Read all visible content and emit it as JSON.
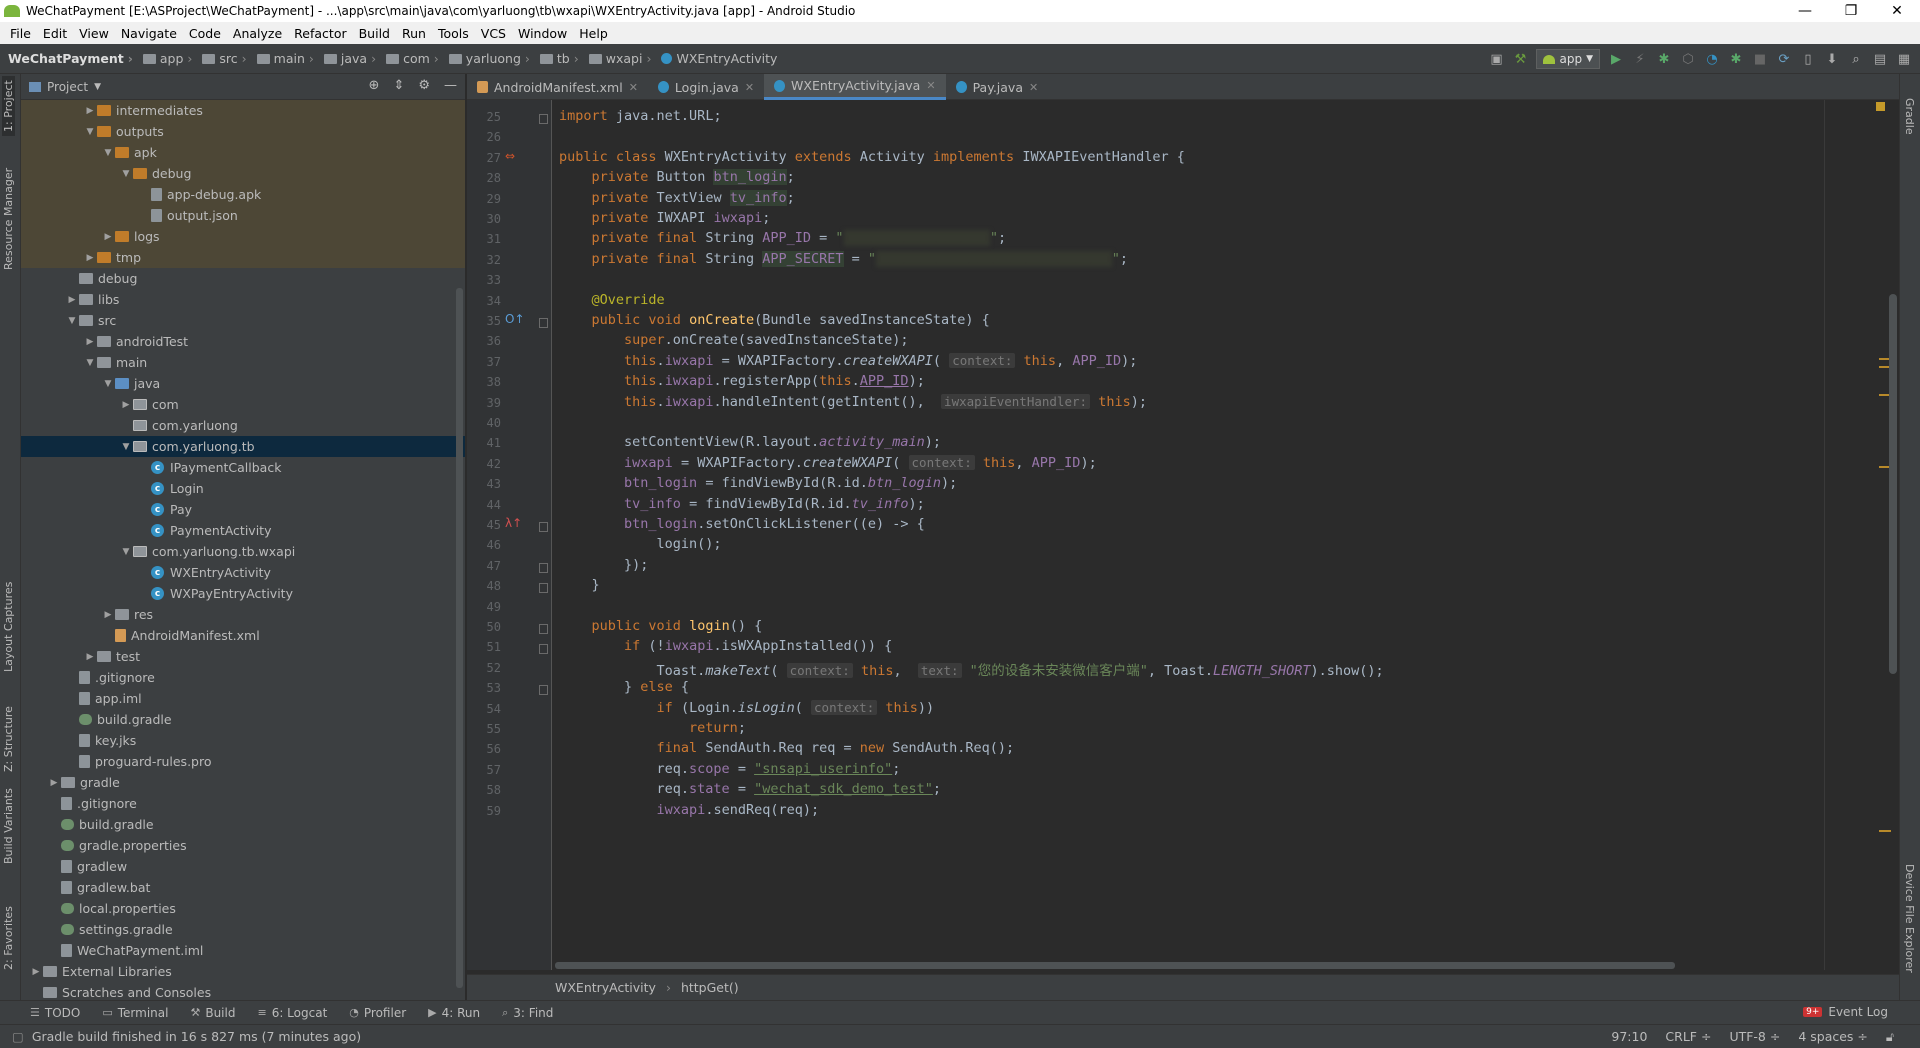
{
  "window": {
    "title": "WeChatPayment [E:\\ASProject\\WeChatPayment] - ...\\app\\src\\main\\java\\com\\yarluong\\tb\\wxapi\\WXEntryActivity.java [app] - Android Studio",
    "minimize": "—",
    "maximize": "❐",
    "close": "✕"
  },
  "menu": [
    "File",
    "Edit",
    "View",
    "Navigate",
    "Code",
    "Analyze",
    "Refactor",
    "Build",
    "Run",
    "Tools",
    "VCS",
    "Window",
    "Help"
  ],
  "breadcrumbs": [
    "WeChatPayment",
    "app",
    "src",
    "main",
    "java",
    "com",
    "yarluong",
    "tb",
    "wxapi",
    "WXEntryActivity"
  ],
  "run_config": "app",
  "left_strip": [
    "1: Project",
    "Resource Manager",
    "Layout Captures",
    "Z: Structure",
    "Build Variants",
    "2: Favorites"
  ],
  "right_strip": [
    "Gradle",
    "Device File Explorer"
  ],
  "project_panel": {
    "title": "Project",
    "tree": [
      {
        "label": "intermediates",
        "depth": 3,
        "arrow": "▶",
        "icon": "orange",
        "state": "excluded"
      },
      {
        "label": "outputs",
        "depth": 3,
        "arrow": "▼",
        "icon": "orange",
        "state": "excluded"
      },
      {
        "label": "apk",
        "depth": 4,
        "arrow": "▼",
        "icon": "orange",
        "state": "excluded"
      },
      {
        "label": "debug",
        "depth": 5,
        "arrow": "▼",
        "icon": "orange",
        "state": "excluded"
      },
      {
        "label": "app-debug.apk",
        "depth": 6,
        "arrow": "",
        "icon": "file",
        "state": "excluded"
      },
      {
        "label": "output.json",
        "depth": 6,
        "arrow": "",
        "icon": "file",
        "state": "excluded"
      },
      {
        "label": "logs",
        "depth": 4,
        "arrow": "▶",
        "icon": "orange",
        "state": "excluded"
      },
      {
        "label": "tmp",
        "depth": 3,
        "arrow": "▶",
        "icon": "orange",
        "state": "excluded"
      },
      {
        "label": "debug",
        "depth": 2,
        "arrow": "",
        "icon": "folder",
        "state": ""
      },
      {
        "label": "libs",
        "depth": 2,
        "arrow": "▶",
        "icon": "folder",
        "state": ""
      },
      {
        "label": "src",
        "depth": 2,
        "arrow": "▼",
        "icon": "folder",
        "state": ""
      },
      {
        "label": "androidTest",
        "depth": 3,
        "arrow": "▶",
        "icon": "folder",
        "state": ""
      },
      {
        "label": "main",
        "depth": 3,
        "arrow": "▼",
        "icon": "folder",
        "state": ""
      },
      {
        "label": "java",
        "depth": 4,
        "arrow": "▼",
        "icon": "blue",
        "state": ""
      },
      {
        "label": "com",
        "depth": 5,
        "arrow": "▶",
        "icon": "pkg",
        "state": ""
      },
      {
        "label": "com.yarluong",
        "depth": 5,
        "arrow": "",
        "icon": "pkg",
        "state": ""
      },
      {
        "label": "com.yarluong.tb",
        "depth": 5,
        "arrow": "▼",
        "icon": "pkg",
        "state": "selected"
      },
      {
        "label": "IPaymentCallback",
        "depth": 6,
        "arrow": "",
        "icon": "class",
        "state": ""
      },
      {
        "label": "Login",
        "depth": 6,
        "arrow": "",
        "icon": "class",
        "state": ""
      },
      {
        "label": "Pay",
        "depth": 6,
        "arrow": "",
        "icon": "class",
        "state": ""
      },
      {
        "label": "PaymentActivity",
        "depth": 6,
        "arrow": "",
        "icon": "class",
        "state": ""
      },
      {
        "label": "com.yarluong.tb.wxapi",
        "depth": 5,
        "arrow": "▼",
        "icon": "pkg",
        "state": ""
      },
      {
        "label": "WXEntryActivity",
        "depth": 6,
        "arrow": "",
        "icon": "class",
        "state": ""
      },
      {
        "label": "WXPayEntryActivity",
        "depth": 6,
        "arrow": "",
        "icon": "class",
        "state": ""
      },
      {
        "label": "res",
        "depth": 4,
        "arrow": "▶",
        "icon": "folder",
        "state": ""
      },
      {
        "label": "AndroidManifest.xml",
        "depth": 4,
        "arrow": "",
        "icon": "xml",
        "state": ""
      },
      {
        "label": "test",
        "depth": 3,
        "arrow": "▶",
        "icon": "folder",
        "state": ""
      },
      {
        "label": ".gitignore",
        "depth": 2,
        "arrow": "",
        "icon": "file",
        "state": ""
      },
      {
        "label": "app.iml",
        "depth": 2,
        "arrow": "",
        "icon": "file",
        "state": ""
      },
      {
        "label": "build.gradle",
        "depth": 2,
        "arrow": "",
        "icon": "gradle",
        "state": ""
      },
      {
        "label": "key.jks",
        "depth": 2,
        "arrow": "",
        "icon": "file",
        "state": ""
      },
      {
        "label": "proguard-rules.pro",
        "depth": 2,
        "arrow": "",
        "icon": "file",
        "state": ""
      },
      {
        "label": "gradle",
        "depth": 1,
        "arrow": "▶",
        "icon": "folder",
        "state": ""
      },
      {
        "label": ".gitignore",
        "depth": 1,
        "arrow": "",
        "icon": "file",
        "state": ""
      },
      {
        "label": "build.gradle",
        "depth": 1,
        "arrow": "",
        "icon": "gradle",
        "state": ""
      },
      {
        "label": "gradle.properties",
        "depth": 1,
        "arrow": "",
        "icon": "gradle",
        "state": ""
      },
      {
        "label": "gradlew",
        "depth": 1,
        "arrow": "",
        "icon": "file",
        "state": ""
      },
      {
        "label": "gradlew.bat",
        "depth": 1,
        "arrow": "",
        "icon": "file",
        "state": ""
      },
      {
        "label": "local.properties",
        "depth": 1,
        "arrow": "",
        "icon": "gradle",
        "state": ""
      },
      {
        "label": "settings.gradle",
        "depth": 1,
        "arrow": "",
        "icon": "gradle",
        "state": ""
      },
      {
        "label": "WeChatPayment.iml",
        "depth": 1,
        "arrow": "",
        "icon": "file",
        "state": ""
      },
      {
        "label": "External Libraries",
        "depth": 0,
        "arrow": "▶",
        "icon": "folder",
        "state": ""
      },
      {
        "label": "Scratches and Consoles",
        "depth": 0,
        "arrow": "",
        "icon": "folder",
        "state": ""
      }
    ]
  },
  "tabs": [
    {
      "label": "AndroidManifest.xml",
      "color": "#d49a55",
      "active": false
    },
    {
      "label": "Login.java",
      "color": "#3592c4",
      "active": false
    },
    {
      "label": "WXEntryActivity.java",
      "color": "#3592c4",
      "active": true
    },
    {
      "label": "Pay.java",
      "color": "#3592c4",
      "active": false
    }
  ],
  "code_lines": [
    {
      "n": "25",
      "html": "<span class=\"kw\">import</span> java.net.URL;"
    },
    {
      "n": "26",
      "html": ""
    },
    {
      "n": "27",
      "html": "<span class=\"kw\">public class</span> WXEntryActivity <span class=\"kw\">extends</span> Activity <span class=\"kw\">implements</span> IWXAPIEventHandler {"
    },
    {
      "n": "28",
      "html": "    <span class=\"kw\">private</span> Button <span class=\"fld hl\">btn_login</span>;"
    },
    {
      "n": "29",
      "html": "    <span class=\"kw\">private</span> TextView <span class=\"fld hl\">tv_info</span>;"
    },
    {
      "n": "30",
      "html": "    <span class=\"kw\">private</span> IWXAPI <span class=\"fld\">iwxapi</span>;"
    },
    {
      "n": "31",
      "html": "    <span class=\"kw\">private final</span> String <span class=\"fld\">APP_ID</span> = <span class=\"str\">\"<span class=\"blur\">wx0000000000000000</span>\"</span>;"
    },
    {
      "n": "32",
      "html": "    <span class=\"kw\">private final</span> String <span class=\"fld hl\">APP_SECRET</span> = <span class=\"str\">\"<span class=\"blur\">00000000000000000000000000000</span>\"</span>;"
    },
    {
      "n": "33",
      "html": ""
    },
    {
      "n": "34",
      "html": "    <span class=\"ann\">@Override</span>"
    },
    {
      "n": "35",
      "html": "    <span class=\"kw\">public void</span> <span class=\"mth\">onCreate</span>(Bundle savedInstanceState) {"
    },
    {
      "n": "36",
      "html": "        <span class=\"kw\">super</span>.onCreate(savedInstanceState);"
    },
    {
      "n": "37",
      "html": "        <span class=\"kw\">this</span>.<span class=\"fld\">iwxapi</span> = WXAPIFactory.<span class=\"ital\">createWXAPI</span>( <span class=\"hint\">context:</span> <span class=\"kw\">this</span>, <span class=\"fld\">APP_ID</span>);"
    },
    {
      "n": "38",
      "html": "        <span class=\"kw\">this</span>.<span class=\"fld\">iwxapi</span>.registerApp(<span class=\"kw\">this</span>.<span class=\"fld\" style=\"text-decoration:underline\">APP_ID</span>);"
    },
    {
      "n": "39",
      "html": "        <span class=\"kw\">this</span>.<span class=\"fld\">iwxapi</span>.handleIntent(getIntent(),  <span class=\"hint\">iwxapiEventHandler:</span> <span class=\"kw\">this</span>);"
    },
    {
      "n": "40",
      "html": ""
    },
    {
      "n": "41",
      "html": "        setContentView(R.layout.<span class=\"fld ital\">activity_main</span>);"
    },
    {
      "n": "42",
      "html": "        <span class=\"fld\">iwxapi</span> = WXAPIFactory.<span class=\"ital\">createWXAPI</span>( <span class=\"hint\">context:</span> <span class=\"kw\">this</span>, <span class=\"fld\">APP_ID</span>);"
    },
    {
      "n": "43",
      "html": "        <span class=\"fld\">btn_login</span> = findViewById(R.id.<span class=\"fld ital\">btn_login</span>);"
    },
    {
      "n": "44",
      "html": "        <span class=\"fld\">tv_info</span> = findViewById(R.id.<span class=\"fld ital\">tv_info</span>);"
    },
    {
      "n": "45",
      "html": "        <span class=\"fld\">btn_login</span>.setOnClickListener((e) -> {"
    },
    {
      "n": "46",
      "html": "            login();"
    },
    {
      "n": "47",
      "html": "        });"
    },
    {
      "n": "48",
      "html": "    }"
    },
    {
      "n": "49",
      "html": ""
    },
    {
      "n": "50",
      "html": "    <span class=\"kw\">public void</span> <span class=\"mth\">login</span>() {"
    },
    {
      "n": "51",
      "html": "        <span class=\"kw\">if</span> (!<span class=\"fld\">iwxapi</span>.isWXAppInstalled()) {"
    },
    {
      "n": "52",
      "html": "            Toast.<span class=\"ital\">makeText</span>( <span class=\"hint\">context:</span> <span class=\"kw\">this</span>,  <span class=\"hint\">text:</span> <span class=\"str\">\"您的设备未安装微信客户端\"</span>, Toast.<span class=\"fld ital\">LENGTH_SHORT</span>).show();"
    },
    {
      "n": "53",
      "html": "        } <span class=\"kw\">else</span> {"
    },
    {
      "n": "54",
      "html": "            <span class=\"kw\">if</span> (Login.<span class=\"ital\">isLogin</span>( <span class=\"hint\">context:</span> <span class=\"kw\">this</span>))"
    },
    {
      "n": "55",
      "html": "                <span class=\"kw\">return</span>;"
    },
    {
      "n": "56",
      "html": "            <span class=\"kw\">final</span> SendAuth.Req req = <span class=\"kw\">new</span> SendAuth.Req();"
    },
    {
      "n": "57",
      "html": "            req.<span class=\"fld\">scope</span> = <span class=\"str\" style=\"text-decoration:underline\">\"snsapi_userinfo\"</span>;"
    },
    {
      "n": "58",
      "html": "            req.<span class=\"fld\">state</span> = <span class=\"str\" style=\"text-decoration:underline\">\"wechat_sdk_demo_test\"</span>;"
    },
    {
      "n": "59",
      "html": "            <span class=\"fld\">iwxapi</span>.sendReq(req);"
    }
  ],
  "editor_breadcrumb": [
    "WXEntryActivity",
    "httpGet()"
  ],
  "tool_windows": [
    {
      "icon": "☰",
      "label": "TODO"
    },
    {
      "icon": "▭",
      "label": "Terminal"
    },
    {
      "icon": "⚒",
      "label": "Build"
    },
    {
      "icon": "≡",
      "label": "6: Logcat"
    },
    {
      "icon": "◔",
      "label": "Profiler"
    },
    {
      "icon": "▶",
      "label": "4: Run"
    },
    {
      "icon": "⌕",
      "label": "3: Find"
    }
  ],
  "event_log": {
    "badge": "9+",
    "label": "Event Log"
  },
  "status": {
    "message": "Gradle build finished in 16 s 827 ms (7 minutes ago)",
    "position": "97:10",
    "line_sep": "CRLF ÷",
    "encoding": "UTF-8 ÷",
    "indent": "4 spaces ÷"
  }
}
